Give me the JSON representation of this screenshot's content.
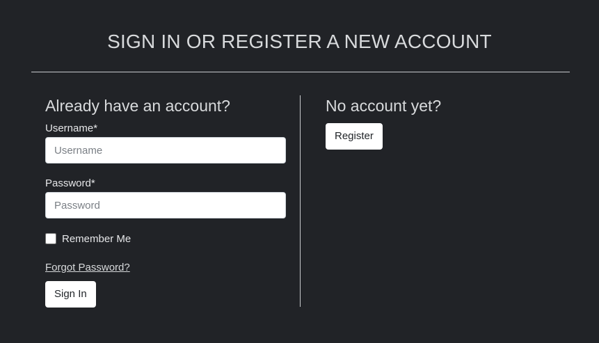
{
  "page": {
    "title": "SIGN IN OR REGISTER A NEW ACCOUNT"
  },
  "login": {
    "heading": "Already have an account?",
    "username_label": "Username*",
    "username_placeholder": "Username",
    "username_value": "",
    "password_label": "Password*",
    "password_placeholder": "Password",
    "password_value": "",
    "remember_label": "Remember Me",
    "remember_checked": false,
    "forgot_label": "Forgot Password?",
    "signin_label": "Sign In"
  },
  "register": {
    "heading": "No account yet?",
    "button_label": "Register"
  },
  "colors": {
    "background": "#212327",
    "text": "#d8dadc",
    "button_bg": "#ffffff"
  }
}
